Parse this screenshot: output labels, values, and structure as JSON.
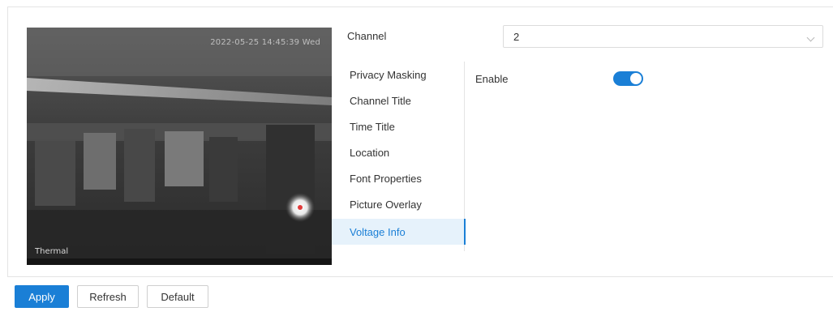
{
  "video": {
    "timestamp": "2022-05-25 14:45:39 Wed",
    "label": "Thermal"
  },
  "channel": {
    "label": "Channel",
    "value": "2"
  },
  "menu": {
    "items": [
      {
        "label": "Privacy Masking"
      },
      {
        "label": "Channel Title"
      },
      {
        "label": "Time Title"
      },
      {
        "label": "Location"
      },
      {
        "label": "Font Properties"
      },
      {
        "label": "Picture Overlay"
      },
      {
        "label": "Voltage Info"
      }
    ],
    "active": "Voltage Info"
  },
  "settings": {
    "enable_label": "Enable",
    "enabled": true
  },
  "buttons": {
    "apply": "Apply",
    "refresh": "Refresh",
    "default": "Default"
  },
  "colors": {
    "accent": "#1a7fd6",
    "active_bg": "#e6f2fb"
  }
}
